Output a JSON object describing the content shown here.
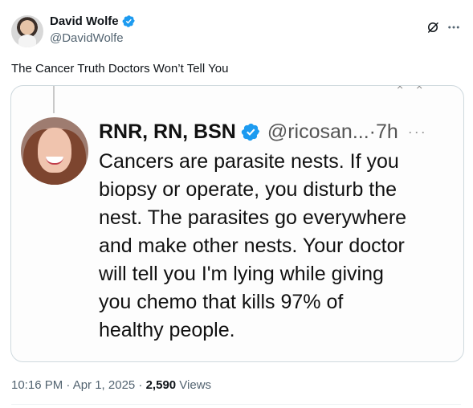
{
  "post": {
    "author": {
      "display_name": "David Wolfe",
      "handle": "@DavidWolfe",
      "verified": true
    },
    "text": "The Cancer Truth Doctors Won’t Tell You",
    "timestamp": "10:16 PM · Apr 1, 2025 · ",
    "views_count": "2,590",
    "views_label": " Views",
    "icons": {
      "grok": "grok-icon",
      "more": "more-icon",
      "verified": "verified-badge-icon"
    },
    "colors": {
      "verified": "#1d9bf0",
      "secondary_text": "#536471",
      "primary_text": "#0f1419",
      "border": "#cfd9de"
    }
  },
  "embedded_screenshot": {
    "display_name": "RNR, RN, BSN",
    "handle_time": "@ricosan...·7h",
    "more": "···",
    "top_marks": "× ×",
    "text": "Cancers are parasite nests. If you\nbiopsy or operate, you disturb the\nnest. The parasites go everywhere\nand make other nests. Your doctor\nwill tell you I'm lying while giving\nyou chemo that kills 97% of\nhealthy people."
  }
}
